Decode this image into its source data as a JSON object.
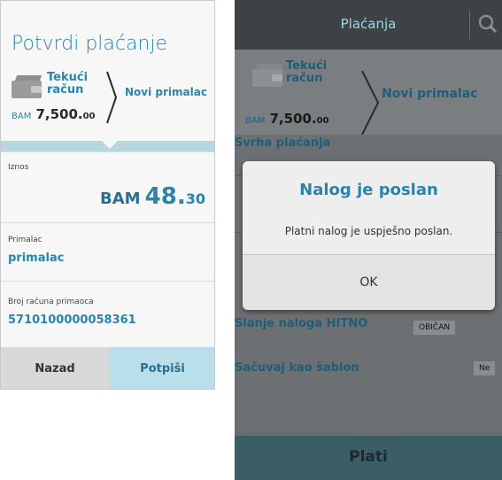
{
  "left": {
    "title": "Potvrdi plaćanje",
    "account": {
      "line1": "Tekući",
      "line2": "račun",
      "currency": "BAM",
      "balance_int": "7,500.",
      "balance_dec": "00"
    },
    "recipient_label": "Novi primalac",
    "amount": {
      "label": "Iznos",
      "currency": "BAM",
      "int": "48.",
      "dec": "30"
    },
    "payee": {
      "label": "Primalac",
      "value": "primalac"
    },
    "account_no": {
      "label": "Broj računa primaoca",
      "value": "5710100000058361"
    },
    "buttons": {
      "back": "Nazad",
      "sign": "Potpiši"
    }
  },
  "right": {
    "title": "Plaćanja",
    "account": {
      "line1": "Tekući",
      "line2": "račun",
      "currency": "BAM",
      "balance_int": "7,500.",
      "balance_dec": "00"
    },
    "recipient_label": "Novi primalac",
    "purpose_label": "Svrha plaćanja",
    "urgent_label": "Slanje naloga HITNO",
    "urgent_value": "OBIČAN",
    "template_label": "Sačuvaj kao šablon",
    "template_value": "Ne",
    "pay_button": "Plati",
    "dialog": {
      "title": "Nalog je poslan",
      "message": "Platni nalog je uspješno poslan.",
      "ok": "OK"
    }
  },
  "colors": {
    "accent": "#2a85a9",
    "accent_light": "#b9dfeb",
    "overlay_bar": "#3f4244"
  }
}
